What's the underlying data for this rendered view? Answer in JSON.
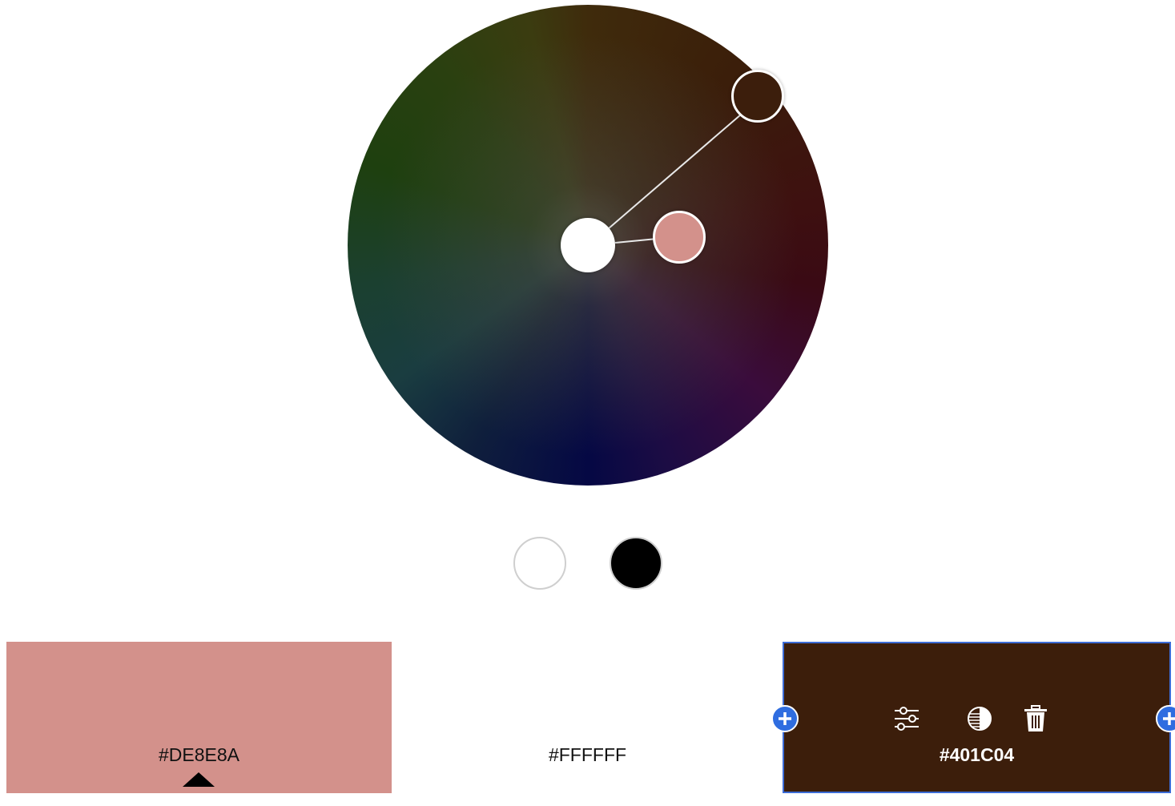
{
  "wheel": {
    "handles": [
      {
        "role": "base",
        "color": "#ffffff"
      },
      {
        "role": "selected",
        "color": "#d3918b"
      },
      {
        "role": "complement",
        "color": "#3c1e0c"
      }
    ]
  },
  "presets": [
    {
      "name": "white",
      "color": "#ffffff"
    },
    {
      "name": "black",
      "color": "#000000"
    }
  ],
  "palette": {
    "swatches": [
      {
        "hex": "#DE8E8A",
        "fill": "#d3918b",
        "active": true
      },
      {
        "hex": "#FFFFFF",
        "fill": "#ffffff",
        "active": false
      },
      {
        "hex": "#401C04",
        "fill": "#3c1e0b",
        "active": false,
        "hovered": true
      }
    ],
    "tools": [
      "sliders-icon",
      "contrast-icon",
      "trash-icon"
    ],
    "add_buttons": [
      "plus-icon",
      "plus-icon"
    ]
  },
  "colors": {
    "accent": "#2f6de0",
    "selection_border": "#3c6cd6"
  }
}
